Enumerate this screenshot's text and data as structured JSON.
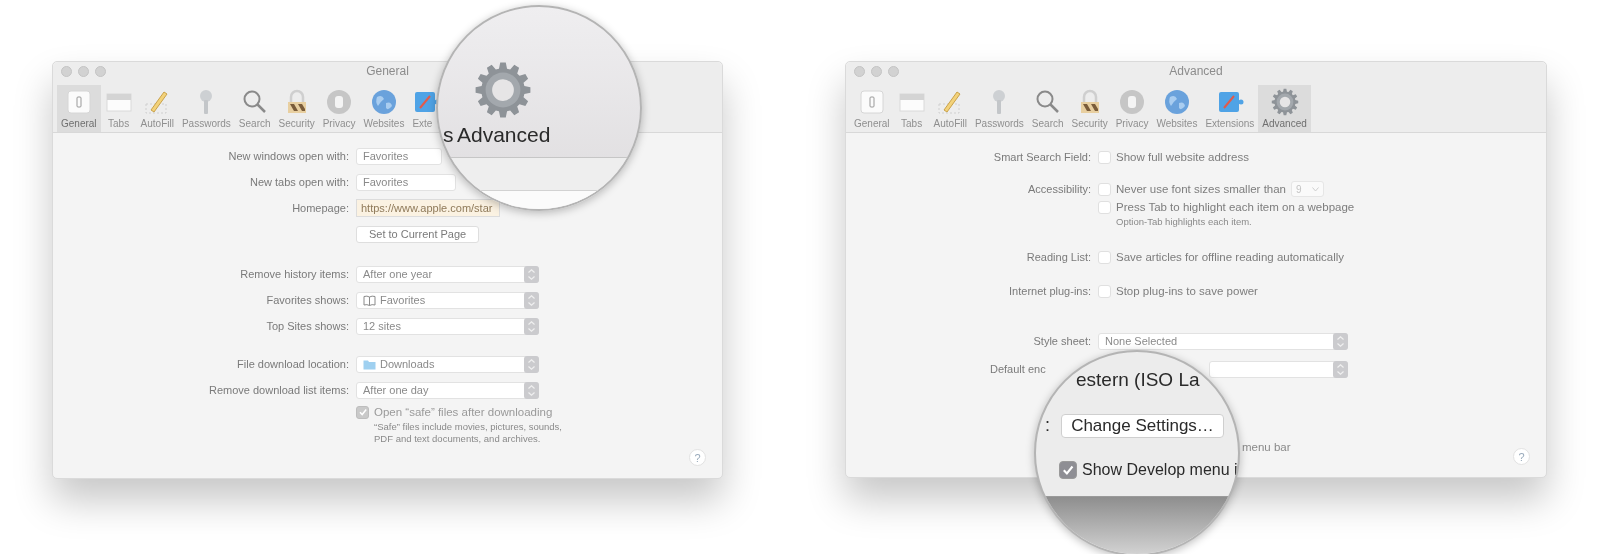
{
  "windows": [
    {
      "title": "General",
      "toolbar": [
        {
          "label": "General",
          "selected": true
        },
        {
          "label": "Tabs",
          "selected": false
        },
        {
          "label": "AutoFill",
          "selected": false
        },
        {
          "label": "Passwords",
          "selected": false
        },
        {
          "label": "Search",
          "selected": false
        },
        {
          "label": "Security",
          "selected": false
        },
        {
          "label": "Privacy",
          "selected": false
        },
        {
          "label": "Websites",
          "selected": false
        },
        {
          "label": "Exte",
          "selected": false,
          "covered": true
        }
      ],
      "sections": [
        [
          {
            "kind": "popup",
            "label": "New windows open with:",
            "value": "Favorites",
            "covered": true
          },
          {
            "kind": "popup",
            "label": "New tabs open with:",
            "value": "Favorites",
            "covered": true
          },
          {
            "kind": "field",
            "label": "Homepage:",
            "value": "https://www.apple.com/star"
          },
          {
            "kind": "button",
            "text": "Set to Current Page"
          }
        ],
        [
          {
            "kind": "popup",
            "label": "Remove history items:",
            "value": "After one year"
          },
          {
            "kind": "popup",
            "label": "Favorites shows:",
            "value": "Favorites"
          },
          {
            "kind": "popup",
            "label": "Top Sites shows:",
            "value": "12 sites"
          }
        ],
        [
          {
            "kind": "popup",
            "label": "File download location:",
            "value": "Downloads"
          },
          {
            "kind": "popup",
            "label": "Remove download list items:",
            "value": "After one day"
          }
        ],
        [
          {
            "kind": "check",
            "text": "Open “safe” files after downloading",
            "checked": true,
            "disabled": true
          },
          {
            "kind": "note",
            "text": "“Safe” files include movies, pictures, sounds, PDF and text documents, and archives."
          }
        ]
      ],
      "help": "?",
      "magnifier": {
        "kind": "toolbar_zoom",
        "fragment": "s",
        "label": "Advanced"
      }
    },
    {
      "title": "Advanced",
      "toolbar": [
        {
          "label": "General",
          "selected": false
        },
        {
          "label": "Tabs",
          "selected": false
        },
        {
          "label": "AutoFill",
          "selected": false
        },
        {
          "label": "Passwords",
          "selected": false
        },
        {
          "label": "Search",
          "selected": false
        },
        {
          "label": "Security",
          "selected": false
        },
        {
          "label": "Privacy",
          "selected": false
        },
        {
          "label": "Websites",
          "selected": false
        },
        {
          "label": "Extensions",
          "selected": false
        },
        {
          "label": "Advanced",
          "selected": true
        }
      ],
      "sections": [
        [
          {
            "kind": "check",
            "label": "Smart Search Field:",
            "text": "Show full website address",
            "checked": false
          }
        ],
        [
          {
            "kind": "check",
            "label": "Accessibility:",
            "text": "Never use font sizes smaller than",
            "checked": false,
            "size": "9"
          },
          {
            "kind": "check",
            "text": "Press Tab to highlight each item on a webpage",
            "checked": false
          },
          {
            "kind": "note",
            "text": "Option-Tab highlights each item."
          }
        ],
        [
          {
            "kind": "check",
            "label": "Reading List:",
            "text": "Save articles for offline reading automatically",
            "checked": false
          }
        ],
        [
          {
            "kind": "check",
            "label": "Internet plug-ins:",
            "text": "Stop plug-ins to save power",
            "checked": false
          }
        ],
        [
          {
            "kind": "popup",
            "label": "Style sheet:",
            "value": "None Selected"
          },
          {
            "kind": "popup",
            "label": "Default enc",
            "covered": true
          }
        ],
        [
          {
            "kind": "tail",
            "text": "menu bar"
          }
        ]
      ],
      "help": "?",
      "magnifier": {
        "kind": "form_zoom",
        "field_value": "estern (ISO La",
        "label": ":",
        "button": "Change Settings…",
        "check": {
          "text": "Show Develop menu i",
          "checked": true
        }
      }
    }
  ]
}
